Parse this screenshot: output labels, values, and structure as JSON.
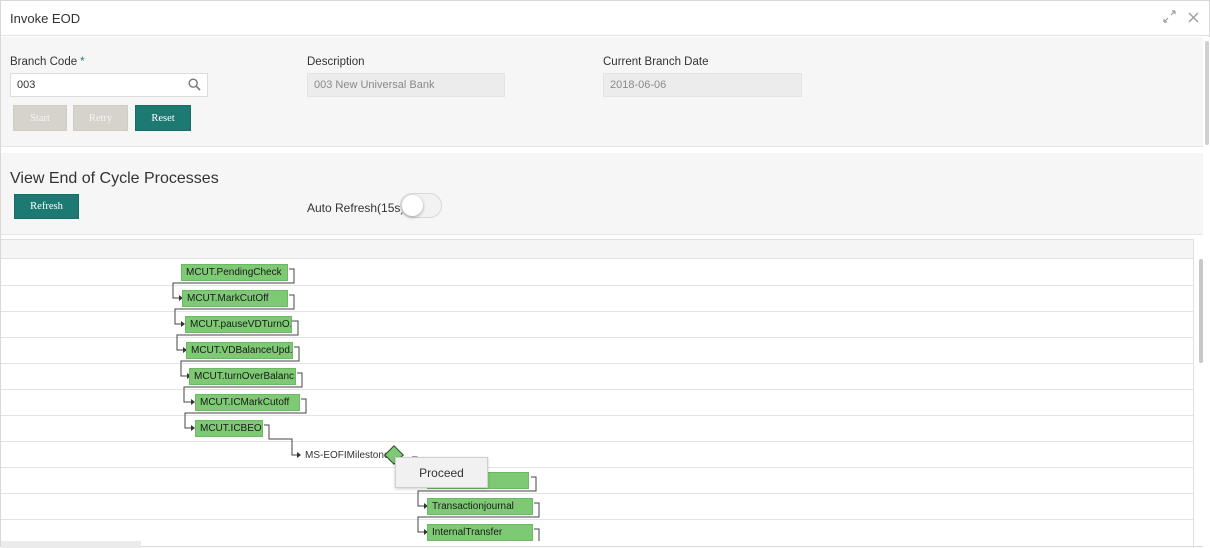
{
  "window": {
    "title": "Invoke EOD",
    "maximize_icon": "expand-icon",
    "close_icon": "close-icon"
  },
  "form": {
    "branch_code_label": "Branch Code",
    "branch_code_required": "*",
    "branch_code_value": "003",
    "description_label": "Description",
    "description_value": "003 New Universal Bank",
    "branch_date_label": "Current Branch Date",
    "branch_date_value": "2018-06-06",
    "start_label": "Start",
    "retry_label": "Retry",
    "reset_label": "Reset"
  },
  "processes": {
    "title": "View End of Cycle Processes",
    "refresh_label": "Refresh",
    "auto_refresh_label": "Auto Refresh(15s)",
    "auto_refresh_on": false
  },
  "flow": {
    "nodes": [
      "MCUT.PendingCheck",
      "MCUT.MarkCutOff",
      "MCUT.pauseVDTurnO...",
      "MCUT.VDBalanceUpd...",
      "MCUT.turnOverBalanc...",
      "MCUT.ICMarkCutoff",
      "MCUT.ICBEOD"
    ],
    "milestone": "MS-EOFIMilestone",
    "after_nodes": [
      "",
      "Transactionjournal",
      "InternalTransfer"
    ],
    "popup_label": "Proceed"
  },
  "colors": {
    "primary_button": "#1d7a72",
    "node_fill": "#7dc974"
  }
}
